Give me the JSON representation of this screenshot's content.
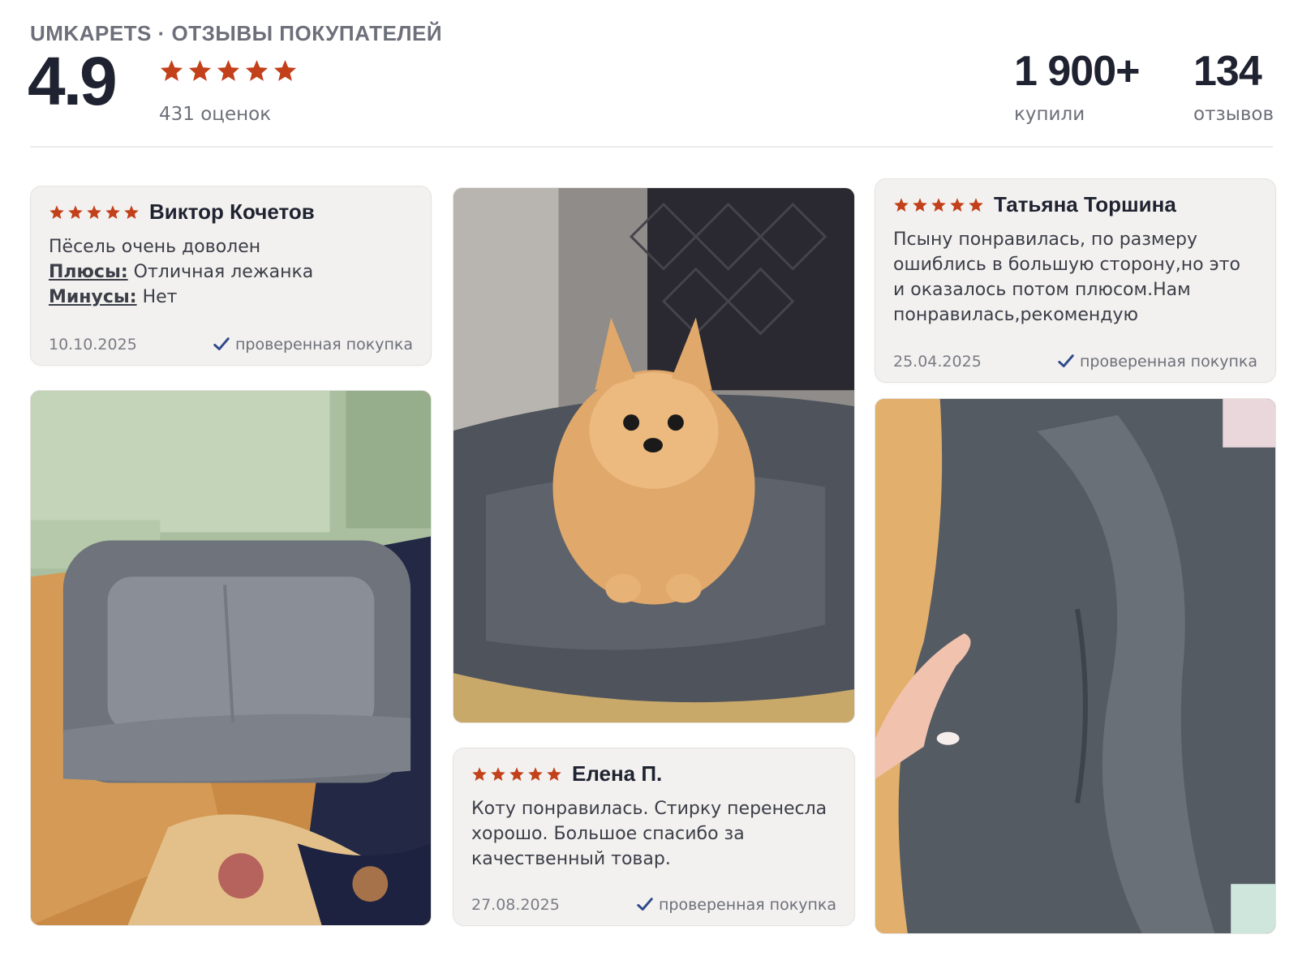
{
  "header": {
    "brand": "UMKAPETS · ОТЗЫВЫ ПОКУПАТЕЛЕЙ",
    "rating": "4.9",
    "stars": 5,
    "rating_count": "431 оценок",
    "stats": [
      {
        "value": "1 900+",
        "label": "купили"
      },
      {
        "value": "134",
        "label": "отзывов"
      }
    ]
  },
  "reviews": [
    {
      "author": "Виктор Кочетов",
      "stars": 5,
      "text": "Пёсель очень доволен",
      "pros_label": "Плюсы:",
      "pros": "Отличная лежанка",
      "cons_label": "Минусы:",
      "cons": "Нет",
      "date": "10.10.2025",
      "verified": "проверенная покупка"
    },
    {
      "author": "Елена П.",
      "stars": 5,
      "text": "Коту понравилась. Стирку перенесла хорошо. Большое спасибо за качественный товар.",
      "date": "27.08.2025",
      "verified": "проверенная покупка"
    },
    {
      "author": "Татьяна Торшина",
      "stars": 5,
      "text": "Псыну понравилась, по размеру ошиблись в большую сторону,но это и оказалось потом плюсом.Нам понравилась,рекомендую",
      "date": "25.04.2025",
      "verified": "проверенная покупка"
    }
  ],
  "colors": {
    "star": "#c2401a",
    "check": "#2f4a8a",
    "card_bg": "#f2f1ef",
    "text_dark": "#1f2230",
    "text_muted": "#6d6f7a"
  },
  "icons": {
    "star": "star-icon",
    "verified": "checkmark-icon"
  }
}
